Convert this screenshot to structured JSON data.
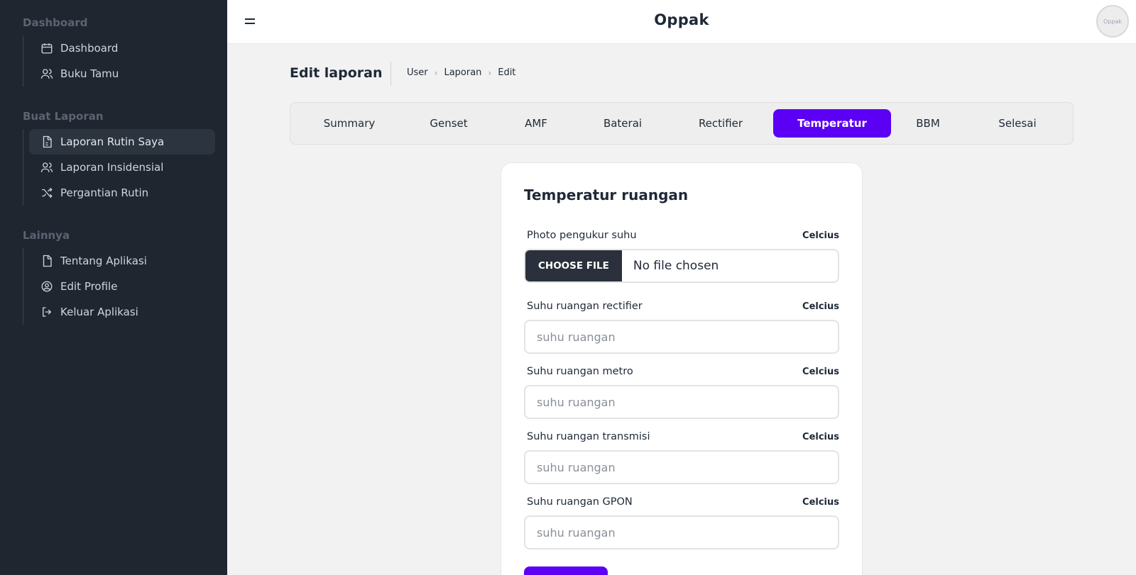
{
  "app": {
    "brand": "Oppak",
    "avatar_text": "Oppak"
  },
  "sidebar": {
    "sections": [
      {
        "title": "Dashboard",
        "items": [
          {
            "label": "Dashboard",
            "icon": "calendar-icon"
          },
          {
            "label": "Buku Tamu",
            "icon": "users-icon"
          }
        ]
      },
      {
        "title": "Buat Laporan",
        "items": [
          {
            "label": "Laporan Rutin Saya",
            "icon": "file-icon",
            "active": true
          },
          {
            "label": "Laporan Insidensial",
            "icon": "users-icon"
          },
          {
            "label": "Pergantian Rutin",
            "icon": "shuffle-icon"
          }
        ]
      },
      {
        "title": "Lainnya",
        "items": [
          {
            "label": "Tentang Aplikasi",
            "icon": "document-icon"
          },
          {
            "label": "Edit Profile",
            "icon": "user-circle-icon"
          },
          {
            "label": "Keluar Aplikasi",
            "icon": "logout-icon"
          }
        ]
      }
    ]
  },
  "header": {
    "title": "Edit laporan",
    "breadcrumb": [
      "User",
      "Laporan",
      "Edit"
    ]
  },
  "tabs": [
    "Summary",
    "Genset",
    "AMF",
    "Baterai",
    "Rectifier",
    "Temperatur",
    "BBM",
    "Selesai"
  ],
  "active_tab": "Temperatur",
  "form": {
    "title": "Temperatur ruangan",
    "photo": {
      "label": "Photo pengukur suhu",
      "unit": "Celcius",
      "button": "CHOOSE FILE",
      "status": "No file chosen"
    },
    "fields": [
      {
        "label": "Suhu ruangan rectifier",
        "unit": "Celcius",
        "placeholder": "suhu ruangan",
        "value": ""
      },
      {
        "label": "Suhu ruangan metro",
        "unit": "Celcius",
        "placeholder": "suhu ruangan",
        "value": ""
      },
      {
        "label": "Suhu ruangan transmisi",
        "unit": "Celcius",
        "placeholder": "suhu ruangan",
        "value": ""
      },
      {
        "label": "Suhu ruangan GPON",
        "unit": "Celcius",
        "placeholder": "suhu ruangan",
        "value": ""
      }
    ]
  },
  "colors": {
    "sidebar_bg": "#1f2630",
    "accent": "#5b00f5",
    "page_bg": "#f2f2f2"
  }
}
